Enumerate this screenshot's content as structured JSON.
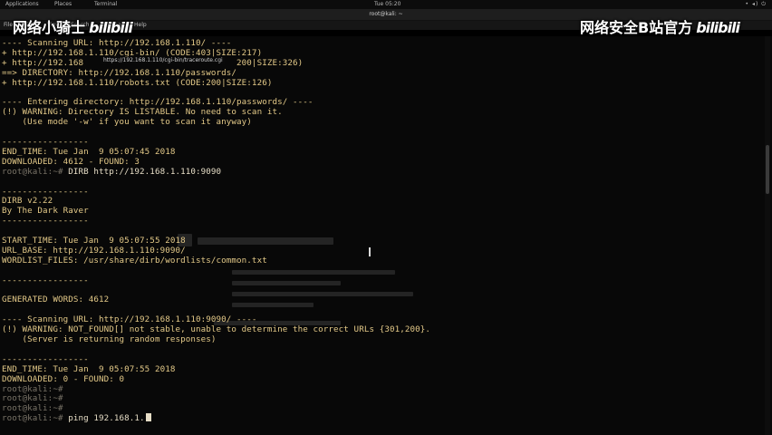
{
  "topbar": {
    "applications": "Applications",
    "places": "Places",
    "terminal": "Terminal",
    "clock": "Tue 05:20",
    "system_icons": "• ◂) ⏻"
  },
  "window": {
    "title": "root@kali: ~",
    "menu": [
      "File",
      "Edit",
      "View",
      "Search",
      "Terminal",
      "Help"
    ]
  },
  "watermark_left": {
    "text": "网络小骑士",
    "logo": "bilibili"
  },
  "watermark_right": {
    "text": "网络安全B站官方",
    "logo": "bilibili"
  },
  "tooltip": "https://192.168.1.110/cgi-bin/traceroute.cgi",
  "terminal_lines": [
    "---- Scanning URL: http://192.168.1.110/ ----",
    "+ http://192.168.1.110/cgi-bin/ (CODE:403|SIZE:217)",
    "+ http://192.168                              200|SIZE:326)",
    "==> DIRECTORY: http://192.168.1.110/passwords/",
    "+ http://192.168.1.110/robots.txt (CODE:200|SIZE:126)",
    "",
    "---- Entering directory: http://192.168.1.110/passwords/ ----",
    "(!) WARNING: Directory IS LISTABLE. No need to scan it.",
    "    (Use mode '-w' if you want to scan it anyway)",
    "",
    "-----------------",
    "END_TIME: Tue Jan  9 05:07:45 2018",
    "DOWNLOADED: 4612 - FOUND: 3",
    {
      "prompt": "root@kali:~#",
      "cmd": " DIRB http://192.168.1.110:9090"
    },
    "",
    "-----------------",
    "DIRB v2.22",
    "By The Dark Raver",
    "-----------------",
    "",
    "START_TIME: Tue Jan  9 05:07:55 2018",
    "URL_BASE: http://192.168.1.110:9090/",
    "WORDLIST_FILES: /usr/share/dirb/wordlists/common.txt",
    "",
    "-----------------",
    "",
    "GENERATED WORDS: 4612",
    "",
    "---- Scanning URL: http://192.168.1.110:9090/ ----",
    "(!) WARNING: NOT_FOUND[] not stable, unable to determine the correct URLs {301,200}.",
    "    (Server is returning random responses)",
    "",
    "-----------------",
    "END_TIME: Tue Jan  9 05:07:55 2018",
    "DOWNLOADED: 0 - FOUND: 0",
    {
      "prompt": "root@kali:~#",
      "cmd": ""
    },
    {
      "prompt": "root@kali:~#",
      "cmd": ""
    },
    {
      "prompt": "root@kali:~#",
      "cmd": ""
    },
    {
      "prompt": "root@kali:~#",
      "cmd": " ping 192.168.1.",
      "cursor": true
    }
  ]
}
